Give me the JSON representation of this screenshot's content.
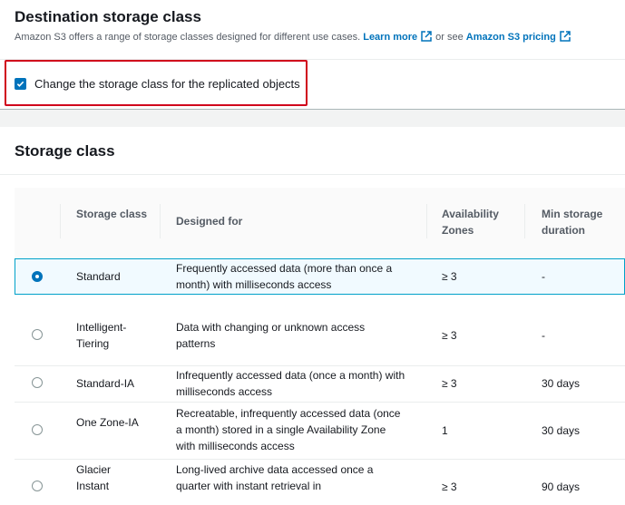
{
  "destination": {
    "title": "Destination storage class",
    "description": "Amazon S3 offers a range of storage classes designed for different use cases.",
    "learn_more": "Learn more",
    "or_see": "or see",
    "pricing_link": "Amazon S3 pricing",
    "checkbox_label": "Change the storage class for the replicated objects",
    "checkbox_checked": true
  },
  "storage": {
    "title": "Storage class",
    "headers": {
      "storage_class": "Storage class",
      "designed_for": "Designed for",
      "availability_zones": "Availability Zones",
      "min_storage_duration": "Min storage duration"
    },
    "rows": [
      {
        "name": "Standard",
        "designed_for": "Frequently accessed data (more than once a month) with milliseconds access",
        "zones": "≥ 3",
        "duration": "-",
        "selected": true
      },
      {
        "name": "Intelligent-Tiering",
        "designed_for": "Data with changing or unknown access patterns",
        "zones": "≥ 3",
        "duration": "-",
        "selected": false
      },
      {
        "name": "Standard-IA",
        "designed_for": "Infrequently accessed data (once a month) with milliseconds access",
        "zones": "≥ 3",
        "duration": "30 days",
        "selected": false
      },
      {
        "name": "One Zone-IA",
        "designed_for": "Recreatable, infrequently accessed data (once a month) stored in a single Availability Zone with milliseconds access",
        "zones": "1",
        "duration": "30 days",
        "selected": false
      },
      {
        "name": "Glacier Instant",
        "designed_for": "Long-lived archive data accessed once a quarter with instant retrieval in",
        "zones": "≥ 3",
        "duration": "90 days",
        "selected": false
      }
    ]
  },
  "colors": {
    "link": "#0073bb",
    "highlight": "#d0021b",
    "selected_border": "#00a1c9"
  }
}
